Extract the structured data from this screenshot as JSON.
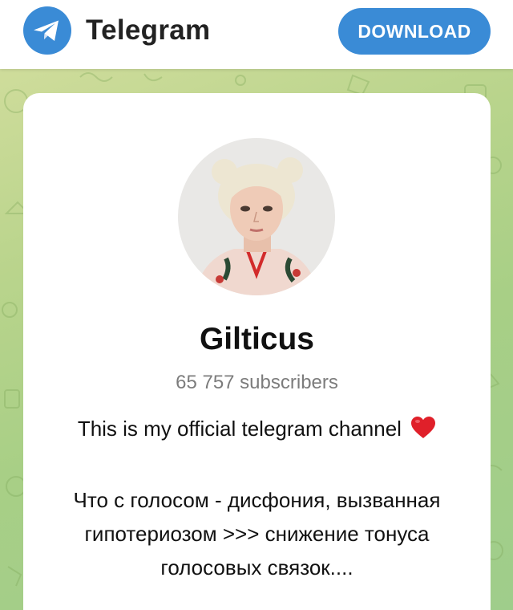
{
  "header": {
    "logo_text": "Telegram",
    "download_label": "DOWNLOAD"
  },
  "channel": {
    "name": "Gilticus",
    "subscribers": "65 757 subscribers",
    "description_line1": "This is my official telegram channel",
    "description_ru": [
      "Что с голосом - дисфония, вызванная",
      "гипотериозом >>> снижение тонуса",
      "голосовых связок...."
    ]
  },
  "icons": {
    "logo": "telegram-paper-plane-icon",
    "heart": "red-heart-emoji"
  },
  "colors": {
    "accent": "#3a8bd6",
    "background_green": "#a8cf86",
    "heart": "#e0202a"
  }
}
